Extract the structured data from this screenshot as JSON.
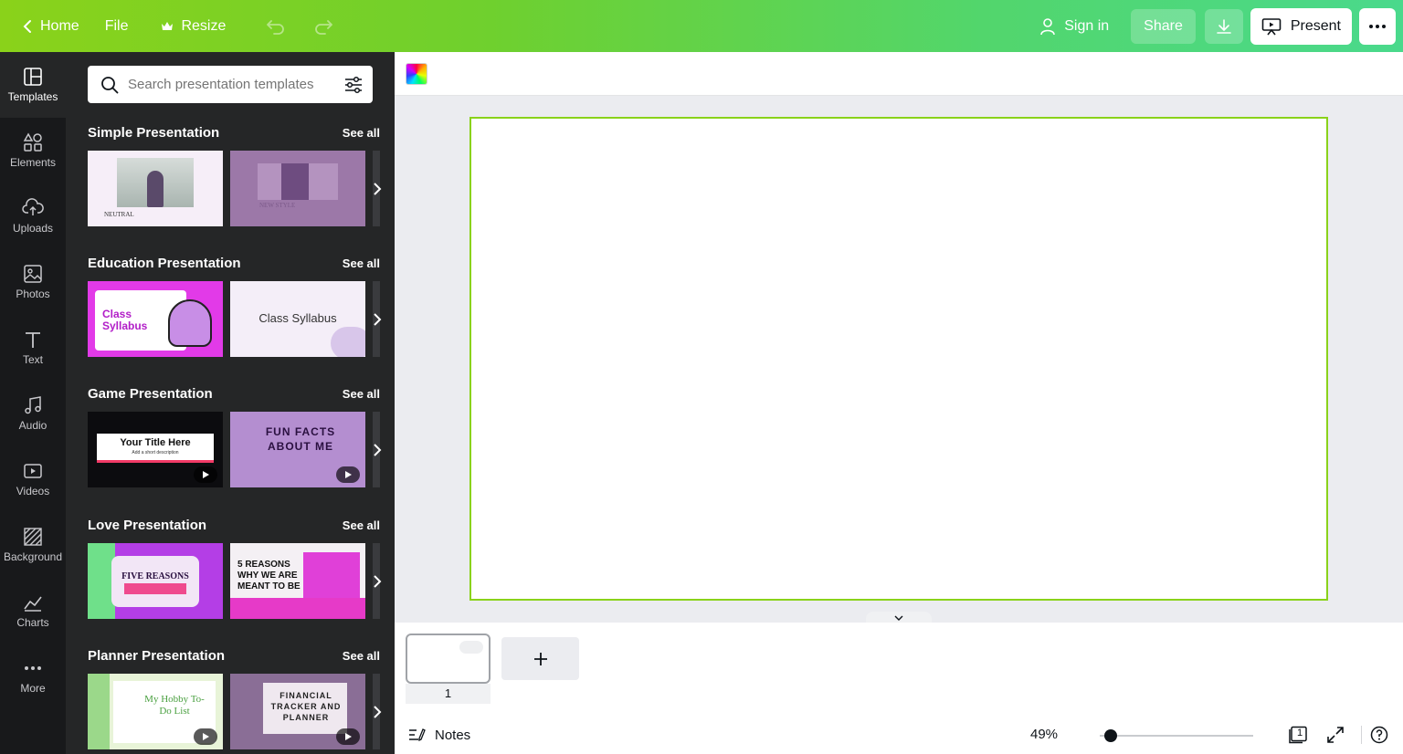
{
  "topbar": {
    "home_label": "Home",
    "file_label": "File",
    "resize_label": "Resize",
    "signin_label": "Sign in",
    "share_label": "Share",
    "present_label": "Present"
  },
  "rail": {
    "items": [
      {
        "label": "Templates",
        "icon": "templates-icon"
      },
      {
        "label": "Elements",
        "icon": "elements-icon"
      },
      {
        "label": "Uploads",
        "icon": "uploads-icon"
      },
      {
        "label": "Photos",
        "icon": "photos-icon"
      },
      {
        "label": "Text",
        "icon": "text-icon"
      },
      {
        "label": "Audio",
        "icon": "audio-icon"
      },
      {
        "label": "Videos",
        "icon": "videos-icon"
      },
      {
        "label": "Background",
        "icon": "background-icon"
      },
      {
        "label": "Charts",
        "icon": "charts-icon"
      },
      {
        "label": "More",
        "icon": "more-icon"
      }
    ]
  },
  "panel": {
    "search_placeholder": "Search presentation templates",
    "see_all": "See all",
    "sections": [
      {
        "title": "Simple Presentation",
        "thumbs": [
          {
            "text": "NEUTRAL"
          },
          {
            "text": "NEW STYLE"
          }
        ]
      },
      {
        "title": "Education Presentation",
        "thumbs": [
          {
            "text": "Class Syllabus"
          },
          {
            "text": "Class Syllabus"
          }
        ]
      },
      {
        "title": "Game Presentation",
        "thumbs": [
          {
            "text": "Your Title Here",
            "sub": "Add a short description"
          },
          {
            "text": "FUN FACTS ABOUT ME"
          }
        ]
      },
      {
        "title": "Love Presentation",
        "thumbs": [
          {
            "text": "FIVE REASONS"
          },
          {
            "text": "5 REASONS WHY WE ARE MEANT TO BE"
          }
        ]
      },
      {
        "title": "Planner Presentation",
        "thumbs": [
          {
            "text": "My Hobby To-Do List"
          },
          {
            "text": "FINANCIAL TRACKER AND PLANNER"
          }
        ]
      }
    ]
  },
  "pages": {
    "current_page_number": "1"
  },
  "footer": {
    "notes_label": "Notes",
    "zoom": "49%",
    "page_count": "1"
  },
  "colors": {
    "topbar_start": "#8ad21a",
    "topbar_end": "#4ad98c",
    "panel_bg": "#252627",
    "rail_bg": "#18191b",
    "slide_border": "#8ad21a"
  }
}
